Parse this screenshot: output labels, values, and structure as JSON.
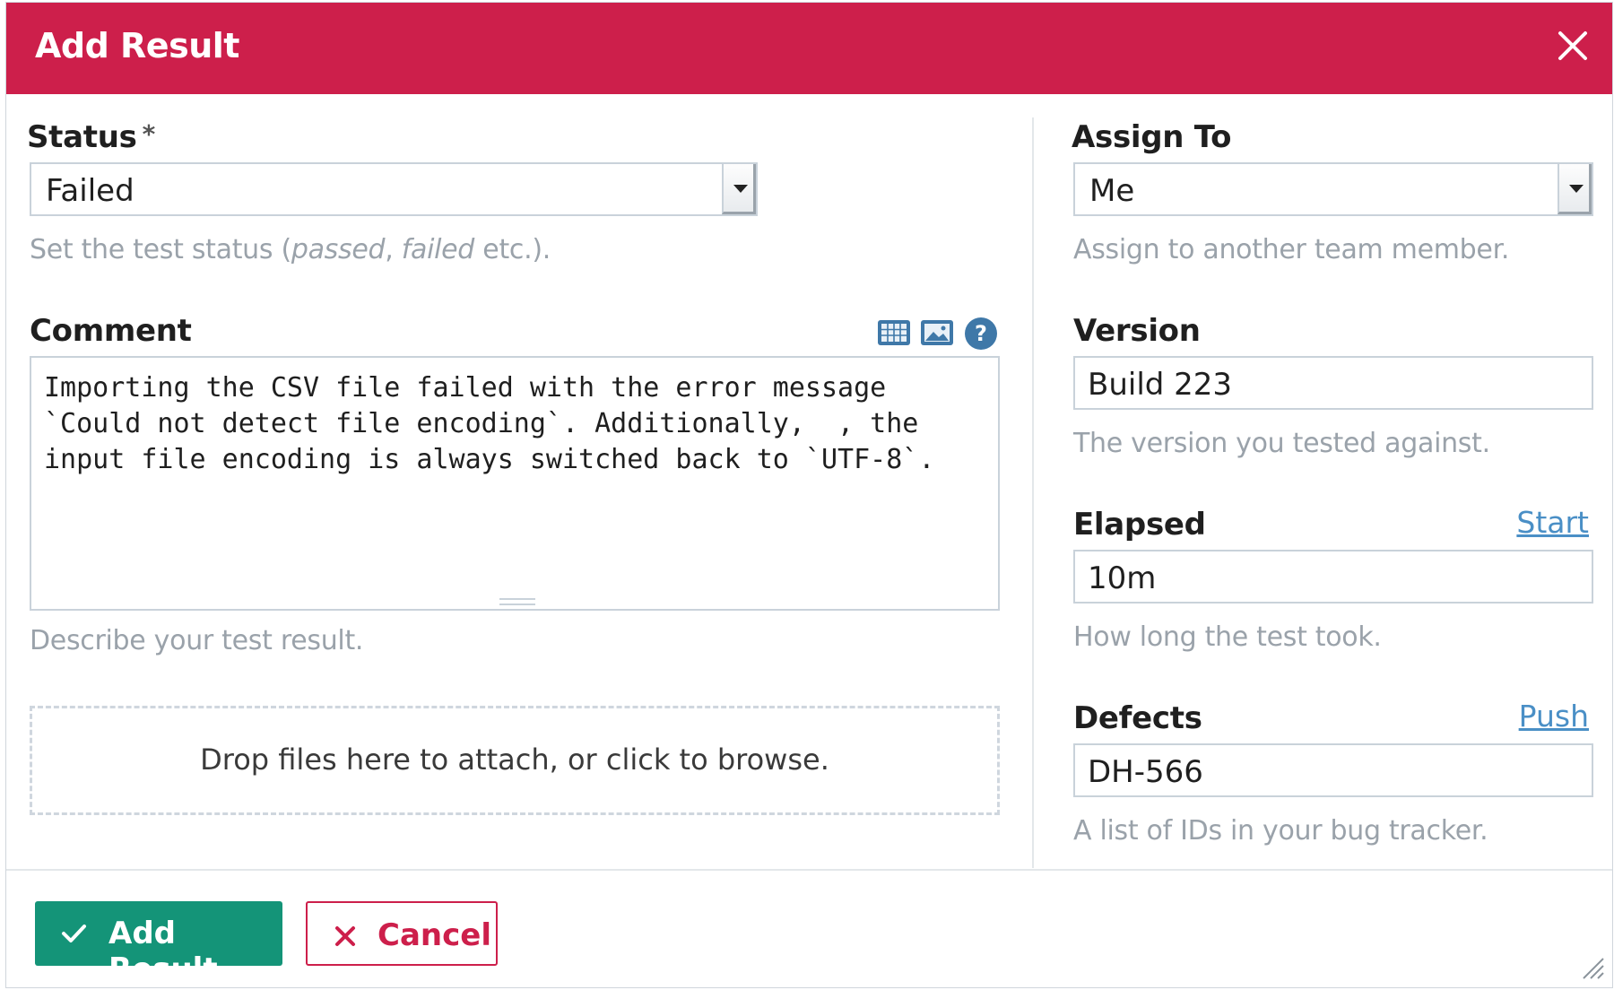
{
  "dialog": {
    "title": "Add Result",
    "close_icon": "close-icon"
  },
  "status": {
    "label": "Status",
    "required_mark": "*",
    "value": "Failed",
    "hint_prefix": "Set the test status ",
    "hint_passed": "passed",
    "hint_sep": ", ",
    "hint_failed": "failed",
    "hint_suffix": " etc.)."
  },
  "comment": {
    "label": "Comment",
    "text": "Importing the CSV file failed with the error message\n`Could not detect file encoding`. Additionally,  , the\ninput file encoding is always switched back to `UTF-8`.",
    "hint": "Describe your test result.",
    "toolbar_icons": [
      "table-icon",
      "image-icon",
      "help-icon"
    ]
  },
  "attachments": {
    "dropzone_text": "Drop files here to attach, or click to browse."
  },
  "assign_to": {
    "label": "Assign To",
    "value": "Me",
    "hint": "Assign to another team member."
  },
  "version": {
    "label": "Version",
    "value": "Build 223",
    "hint": "The version you tested against."
  },
  "elapsed": {
    "label": "Elapsed",
    "link": "Start",
    "value": "10m",
    "hint": "How long the test took."
  },
  "defects": {
    "label": "Defects",
    "link": "Push",
    "value": "DH-566",
    "hint": "A list of IDs in your bug tracker."
  },
  "footer": {
    "submit_label": "Add Result",
    "cancel_label": "Cancel"
  },
  "colors": {
    "header": "#cd1f4b",
    "primary": "#149478",
    "link": "#4a8fc6",
    "icon": "#3f78a8"
  }
}
